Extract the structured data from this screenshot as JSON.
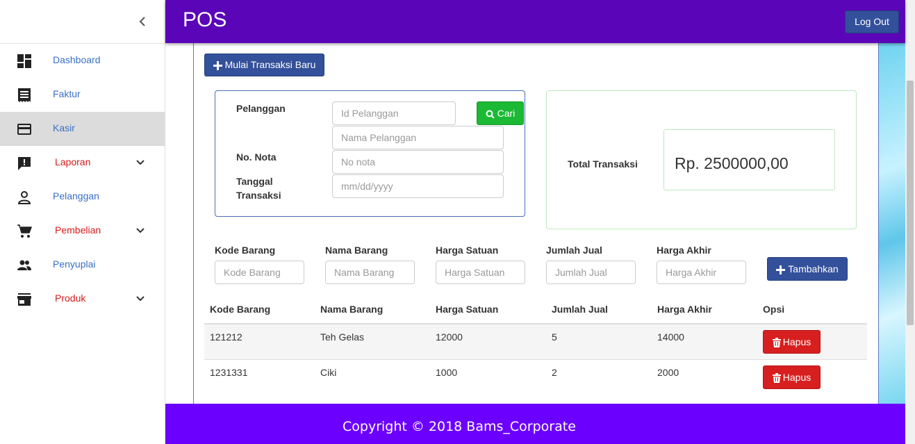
{
  "sidebar": {
    "items": [
      {
        "label": "Dashboard",
        "icon": "dashboard-icon"
      },
      {
        "label": "Faktur",
        "icon": "receipt-icon"
      },
      {
        "label": "Kasir",
        "icon": "credit-card-icon",
        "active": true
      },
      {
        "label": "Laporan",
        "icon": "report-icon",
        "expandable": true
      },
      {
        "label": "Pelanggan",
        "icon": "person-icon"
      },
      {
        "label": "Pembelian",
        "icon": "cart-icon",
        "expandable": true
      },
      {
        "label": "Penyuplai",
        "icon": "people-icon"
      },
      {
        "label": "Produk",
        "icon": "store-icon",
        "expandable": true
      }
    ]
  },
  "header": {
    "title": "POS",
    "logout_label": "Log Out"
  },
  "main": {
    "new_transaction_label": "Mulai Transaksi Baru",
    "form": {
      "customer_label": "Pelanggan",
      "customer_id_placeholder": "Id Pelanggan",
      "search_label": "Cari",
      "customer_name_placeholder": "Nama Pelanggan",
      "invoice_label": "No. Nota",
      "invoice_placeholder": "No nota",
      "date_label_line1": "Tanggal",
      "date_label_line2": "Transaksi",
      "date_placeholder": "mm/dd/yyyy"
    },
    "total": {
      "label": "Total Transaksi",
      "value": "Rp. 2500000,00"
    },
    "item_form": {
      "code_label": "Kode Barang",
      "code_placeholder": "Kode Barang",
      "name_label": "Nama Barang",
      "name_placeholder": "Nama Barang",
      "price_label": "Harga Satuan",
      "price_placeholder": "Harga Satuan",
      "qty_label": "Jumlah Jual",
      "qty_placeholder": "Jumlah Jual",
      "final_label": "Harga Akhir",
      "final_placeholder": "Harga Akhir",
      "add_label": "Tambahkan"
    },
    "table": {
      "headers": [
        "Kode Barang",
        "Nama Barang",
        "Harga Satuan",
        "Jumlah Jual",
        "Harga Akhir",
        "Opsi"
      ],
      "rows": [
        {
          "code": "121212",
          "name": "Teh Gelas",
          "price": "12000",
          "qty": "5",
          "final": "14000",
          "action": "Hapus"
        },
        {
          "code": "1231331",
          "name": "Ciki",
          "price": "1000",
          "qty": "2",
          "final": "2000",
          "action": "Hapus"
        }
      ]
    }
  },
  "footer": {
    "copyright": "Copyright © 2018 Bams_Corporate"
  },
  "colors": {
    "header": "#5b05b8",
    "footer": "#6c00ff",
    "primary_button": "#33509a",
    "success_button": "#1bb934",
    "danger_button": "#d71f1f",
    "sidebar_link": "#3a6fc4",
    "sidebar_expandable_link": "#d61a1a"
  }
}
